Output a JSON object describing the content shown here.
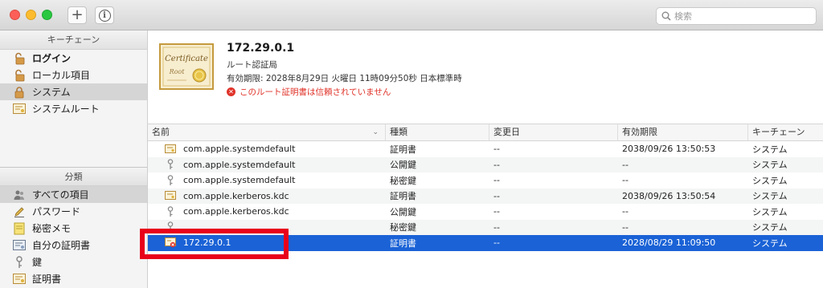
{
  "toolbar": {
    "add_label": "+",
    "search_placeholder": "検索"
  },
  "sidebar": {
    "keychain_header": "キーチェーン",
    "keychains": [
      {
        "label": "ログイン",
        "icon": "lock-open-icon"
      },
      {
        "label": "ローカル項目",
        "icon": "lock-open-icon"
      },
      {
        "label": "システム",
        "icon": "lock-icon"
      },
      {
        "label": "システムルート",
        "icon": "certificate-icon"
      }
    ],
    "category_header": "分類",
    "categories": [
      {
        "label": "すべての項目",
        "icon": "people-icon"
      },
      {
        "label": "パスワード",
        "icon": "pencil-icon"
      },
      {
        "label": "秘密メモ",
        "icon": "note-icon"
      },
      {
        "label": "自分の証明書",
        "icon": "my-certificate-icon"
      },
      {
        "label": "鍵",
        "icon": "key-icon"
      },
      {
        "label": "証明書",
        "icon": "certificate-icon"
      }
    ]
  },
  "detail": {
    "title": "172.29.0.1",
    "kind": "ルート認証局",
    "expires": "有効期限: 2028年8月29日 火曜日 11時09分50秒 日本標準時",
    "warning": "このルート証明書は信頼されていません",
    "cert_image_word": "Certificate",
    "cert_image_sub": "Root",
    "warning_color": "#e0332a"
  },
  "table": {
    "columns": [
      "名前",
      "種類",
      "変更日",
      "有効期限",
      "キーチェーン"
    ],
    "rows": [
      {
        "icon": "certificate-icon",
        "name": "com.apple.systemdefault",
        "kind": "証明書",
        "modified": "--",
        "expires": "2038/09/26 13:50:53",
        "keychain": "システム"
      },
      {
        "icon": "key-icon",
        "name": "com.apple.systemdefault",
        "kind": "公開鍵",
        "modified": "--",
        "expires": "--",
        "keychain": "システム"
      },
      {
        "icon": "key-icon",
        "name": "com.apple.systemdefault",
        "kind": "秘密鍵",
        "modified": "--",
        "expires": "--",
        "keychain": "システム"
      },
      {
        "icon": "certificate-icon",
        "name": "com.apple.kerberos.kdc",
        "kind": "証明書",
        "modified": "--",
        "expires": "2038/09/26 13:50:54",
        "keychain": "システム"
      },
      {
        "icon": "key-icon",
        "name": "com.apple.kerberos.kdc",
        "kind": "公開鍵",
        "modified": "--",
        "expires": "--",
        "keychain": "システム"
      },
      {
        "icon": "key-icon",
        "name": "",
        "kind": "秘密鍵",
        "modified": "--",
        "expires": "--",
        "keychain": "システム"
      },
      {
        "icon": "untrusted-certificate-icon",
        "name": "172.29.0.1",
        "kind": "証明書",
        "modified": "--",
        "expires": "2028/08/29 11:09:50",
        "keychain": "システム"
      }
    ]
  },
  "colors": {
    "selection": "#1a62d6",
    "annotation_box": "#e8001b"
  }
}
